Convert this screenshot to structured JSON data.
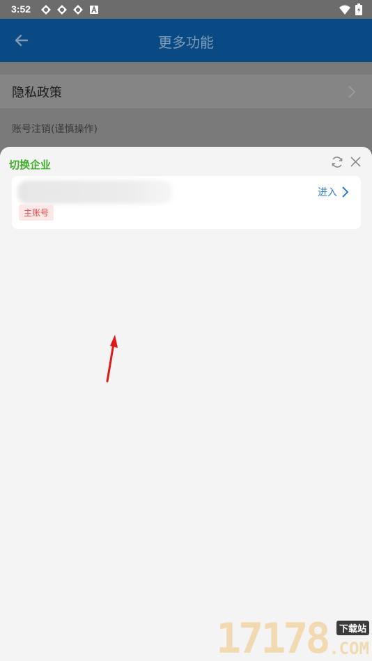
{
  "status_bar": {
    "time": "3:52",
    "left_icons": [
      "notification-icon",
      "notification-icon",
      "notification-icon",
      "a-badge-icon"
    ],
    "right_icons": [
      "wifi-icon",
      "battery-icon"
    ]
  },
  "app_bar": {
    "title": "更多功能",
    "back_icon": "arrow-left-icon"
  },
  "background_menu": {
    "privacy_label": "隐私政策",
    "cancel_account_label": "账号注销(谨慎操作)"
  },
  "sheet": {
    "title": "切换企业",
    "refresh_icon": "refresh-icon",
    "close_icon": "close-icon",
    "companies": [
      {
        "enter_label": "进入",
        "badge": "主账号"
      }
    ]
  },
  "watermark": {
    "digits": "17178",
    "tag": "下载站",
    "domain": ".COM"
  },
  "colors": {
    "app_bar": "#0a4a84",
    "sheet_title": "#3fae2a",
    "enter_link": "#2a7bd0",
    "badge_text": "#e84a4a",
    "badge_bg": "#fde8e8",
    "annotation_arrow": "#e01818"
  }
}
